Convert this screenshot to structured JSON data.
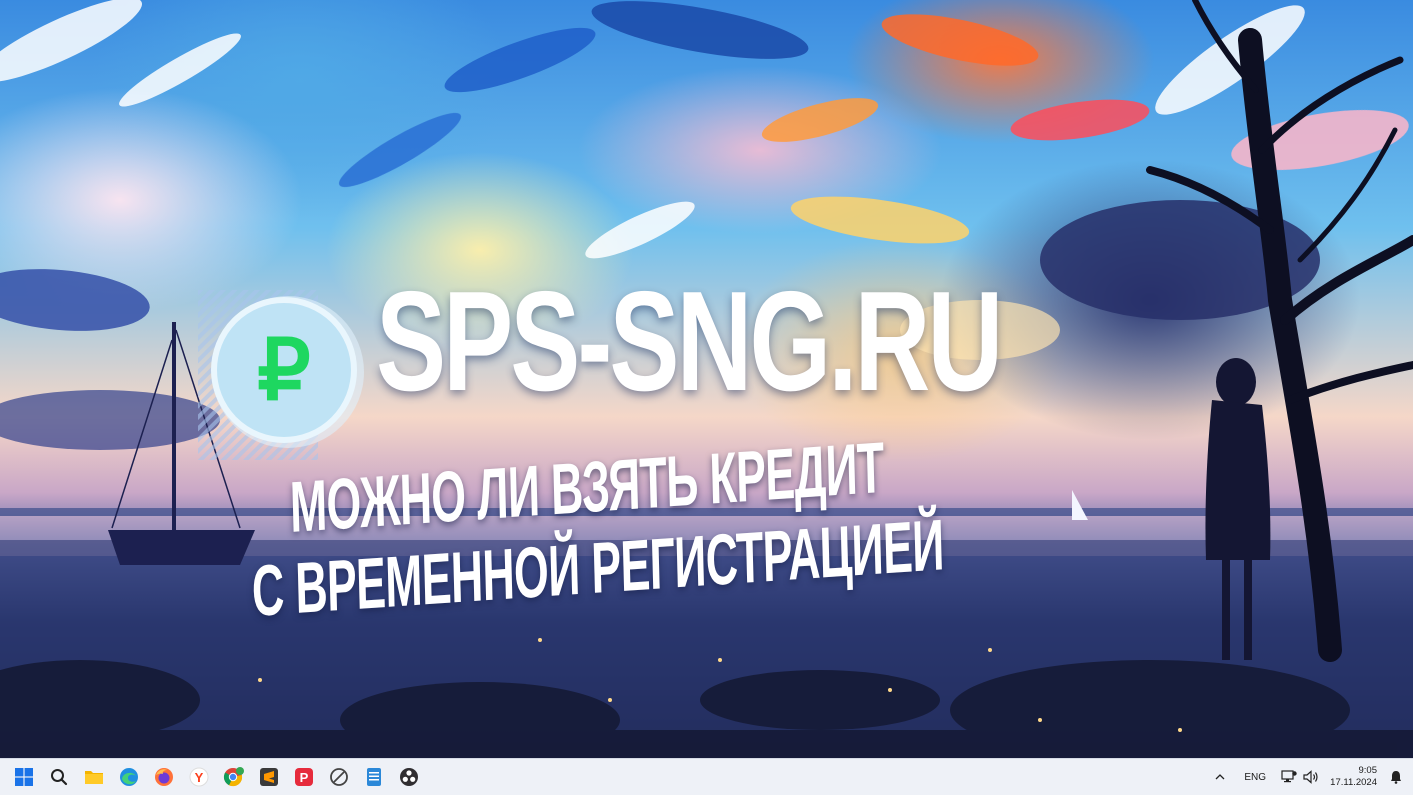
{
  "banner": {
    "site_name": "SPS-SNG.RU",
    "logo_symbol": "₽",
    "headline_line1": "МОЖНО ЛИ ВЗЯТЬ КРЕДИТ",
    "headline_line2": "С ВРЕМЕННОЙ РЕГИСТРАЦИЕЙ"
  },
  "colors": {
    "ruble_green": "#1ed760",
    "badge_fill": "#bfe3f5",
    "taskbar_bg": "#eef1f7"
  },
  "taskbar": {
    "apps": [
      {
        "name": "start-button",
        "icon": "windows-logo-icon"
      },
      {
        "name": "search-button",
        "icon": "search-icon"
      },
      {
        "name": "file-explorer-button",
        "icon": "folder-icon"
      },
      {
        "name": "edge-button",
        "icon": "edge-icon"
      },
      {
        "name": "firefox-button",
        "icon": "firefox-icon"
      },
      {
        "name": "yandex-browser-button",
        "icon": "yandex-icon"
      },
      {
        "name": "chrome-button",
        "icon": "chrome-icon"
      },
      {
        "name": "sublime-text-button",
        "icon": "sublime-icon"
      },
      {
        "name": "app-p-button",
        "icon": "p-app-icon"
      },
      {
        "name": "app-circle-button",
        "icon": "circle-slash-icon"
      },
      {
        "name": "notepad-button",
        "icon": "notepad-icon"
      },
      {
        "name": "obs-button",
        "icon": "obs-icon"
      }
    ],
    "tray": {
      "language": "ENG",
      "time": "9:05",
      "date": "17.11.2024"
    }
  }
}
